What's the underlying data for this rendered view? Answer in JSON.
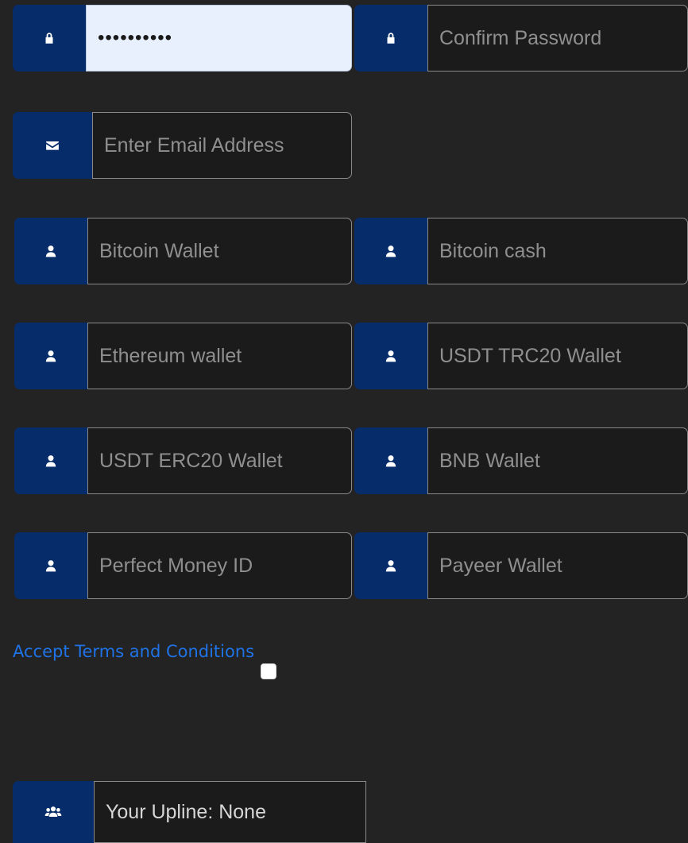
{
  "form": {
    "password": {
      "value": "••••••••••",
      "icon": "lock-icon"
    },
    "confirm_password": {
      "placeholder": "Confirm Password",
      "icon": "lock-icon"
    },
    "email": {
      "placeholder": "Enter Email Address",
      "icon": "envelope-icon"
    },
    "bitcoin_wallet": {
      "placeholder": "Bitcoin Wallet",
      "icon": "user-icon"
    },
    "bitcoin_cash": {
      "placeholder": "Bitcoin cash",
      "icon": "user-icon"
    },
    "ethereum_wallet": {
      "placeholder": "Ethereum wallet",
      "icon": "user-icon"
    },
    "usdt_trc20_wallet": {
      "placeholder": "USDT TRC20 Wallet",
      "icon": "user-icon"
    },
    "usdt_erc20_wallet": {
      "placeholder": "USDT ERC20 Wallet",
      "icon": "user-icon"
    },
    "bnb_wallet": {
      "placeholder": "BNB Wallet",
      "icon": "user-icon"
    },
    "perfect_money_id": {
      "placeholder": "Perfect Money ID",
      "icon": "user-icon"
    },
    "payeer_wallet": {
      "placeholder": "Payeer Wallet",
      "icon": "user-icon"
    },
    "terms": {
      "label": "Accept Terms and Conditions",
      "checked": false
    },
    "upline": {
      "text": "Your Upline: None",
      "icon": "users-icon"
    }
  },
  "colors": {
    "background": "#232323",
    "addon": "#062d69",
    "input_bg": "#1b1b1b",
    "autofill_bg": "#e8f0fe",
    "link": "#1f73e6"
  }
}
